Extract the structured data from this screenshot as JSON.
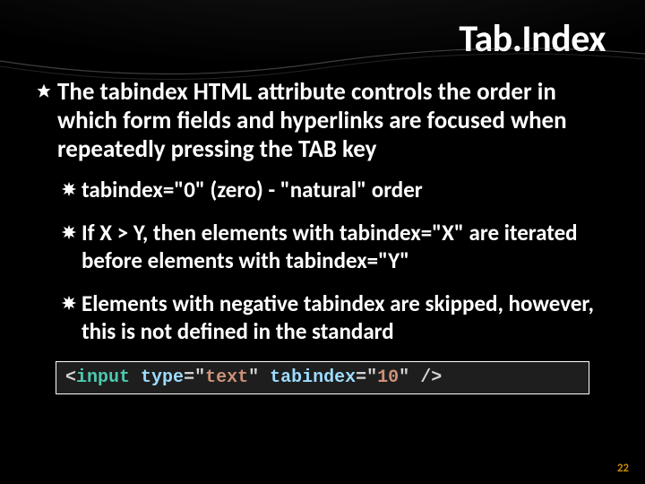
{
  "title": "Tab.Index",
  "bullet1": "The tabindex HTML attribute controls the order in which form fields and hyperlinks are focused when repeatedly pressing the TAB key",
  "sub1": "tabindex=\"0\" (zero) - \"natural\" order",
  "sub2": "If X > Y, then elements with tabindex=\"X\" are iterated before elements with tabindex=\"Y\"",
  "sub3": "Elements with negative tabindex are skipped, however, this is not defined in the standard",
  "code": {
    "p1": "<",
    "tag1": "input",
    "sp1": " ",
    "attr1": "type",
    "eq1": "=\"",
    "val1": "text",
    "q1": "\"",
    "sp2": " ",
    "attr2": "tabindex",
    "eq2": "=\"",
    "val2": "10",
    "q2": "\"",
    "sp3": " ",
    "p2": "/>"
  },
  "page": "22",
  "icons": {
    "star6": "star-6-icon",
    "star8": "star-8-icon"
  }
}
